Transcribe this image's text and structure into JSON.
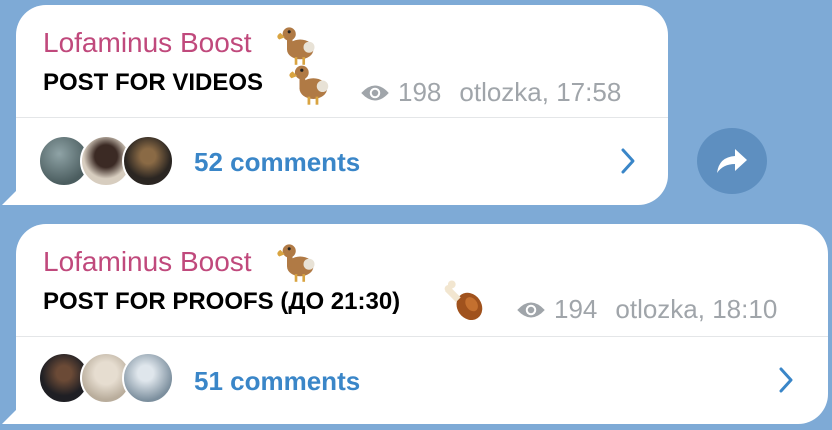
{
  "messages": [
    {
      "author": "Lofaminus Boost",
      "text": "POST FOR VIDEOS",
      "views": "198",
      "meta": "otlozka, 17:58",
      "comments": "52 comments",
      "emoji": [
        "dodo",
        "dodo"
      ]
    },
    {
      "author": "Lofaminus Boost",
      "text": "POST FOR PROOFS (ДО 21:30)",
      "views": "194",
      "meta": "otlozka, 18:10",
      "comments": "51 comments",
      "emoji": [
        "dodo",
        "poultry-leg"
      ]
    }
  ],
  "icons": {
    "views": "eye-icon",
    "chevron": "chevron-right-icon",
    "share": "share-arrow-icon"
  },
  "colors": {
    "background": "#7eaad6",
    "author": "#c0497c",
    "link": "#3a86c8",
    "meta": "#a0a5aa",
    "share_button": "#5e8fc0"
  }
}
